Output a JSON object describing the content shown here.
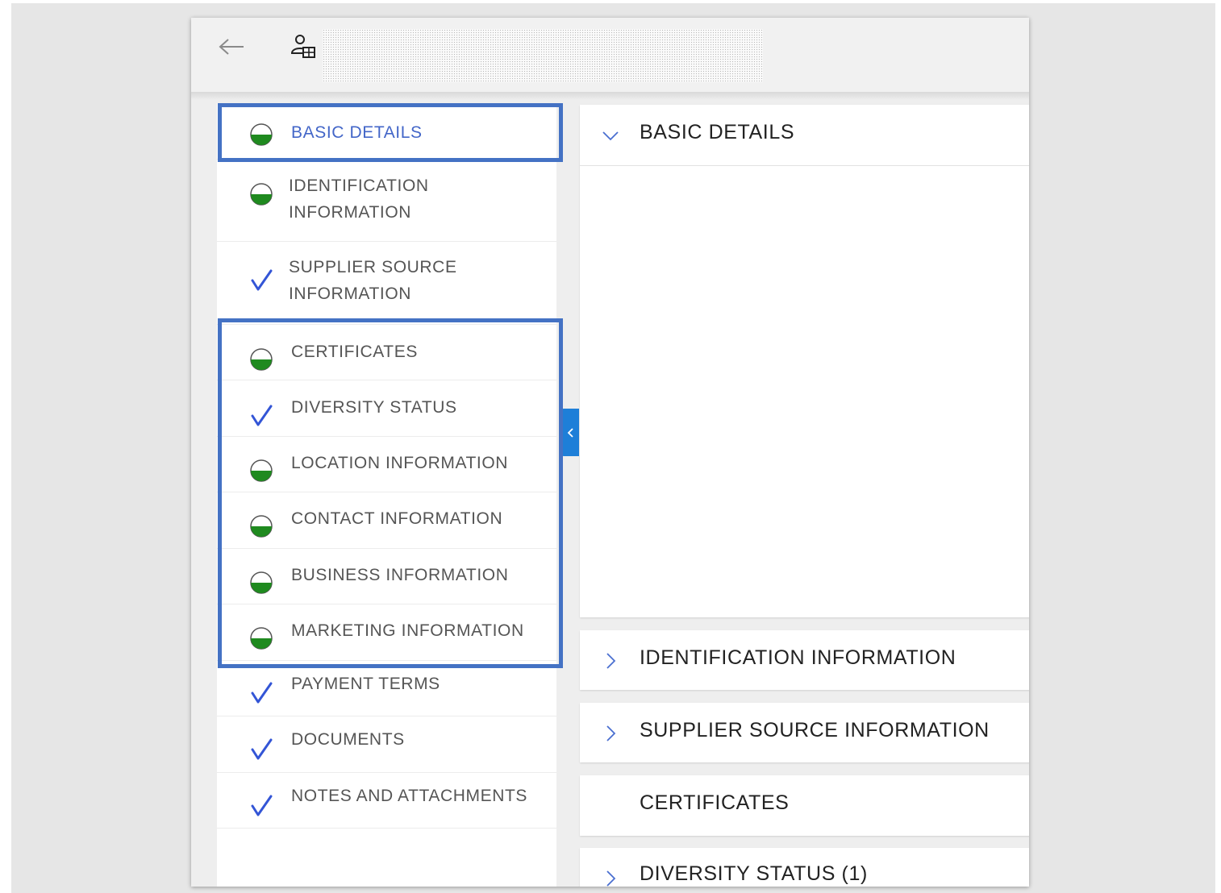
{
  "nav": {
    "items": [
      {
        "label": "BASIC DETAILS",
        "status": "partial",
        "active": true
      },
      {
        "label": "IDENTIFICATION INFORMATION",
        "status": "partial"
      },
      {
        "label": "SUPPLIER SOURCE INFORMATION",
        "status": "complete"
      },
      {
        "label": "CERTIFICATES",
        "status": "partial"
      },
      {
        "label": "DIVERSITY STATUS",
        "status": "complete"
      },
      {
        "label": "LOCATION INFORMATION",
        "status": "partial"
      },
      {
        "label": "CONTACT INFORMATION",
        "status": "partial"
      },
      {
        "label": "BUSINESS INFORMATION",
        "status": "partial"
      },
      {
        "label": "MARKETING INFORMATION",
        "status": "partial"
      },
      {
        "label": "PAYMENT TERMS",
        "status": "complete"
      },
      {
        "label": "DOCUMENTS",
        "status": "complete"
      },
      {
        "label": "NOTES AND ATTACHMENTS",
        "status": "complete"
      }
    ]
  },
  "panels": [
    {
      "title": "BASIC DETAILS",
      "state": "expanded"
    },
    {
      "title": "IDENTIFICATION INFORMATION",
      "state": "collapsed"
    },
    {
      "title": "SUPPLIER SOURCE INFORMATION",
      "state": "collapsed"
    },
    {
      "title": "CERTIFICATES",
      "state": "none"
    },
    {
      "title": "DIVERSITY STATUS (1)",
      "state": "collapsed"
    }
  ],
  "colors": {
    "accent": "#4366c8",
    "highlight_border": "#4472c4",
    "status_partial": "#1f8a1f",
    "status_complete": "#3355d6",
    "collapse_tab": "#1e7fd8"
  },
  "icons": {
    "back": "arrow-left-icon",
    "supplier": "supplier-profile-icon",
    "partial": "half-circle-icon",
    "complete": "checkmark-icon",
    "collapse": "chevron-left-icon",
    "expanded": "chevron-down-icon",
    "collapsed": "chevron-right-icon"
  }
}
